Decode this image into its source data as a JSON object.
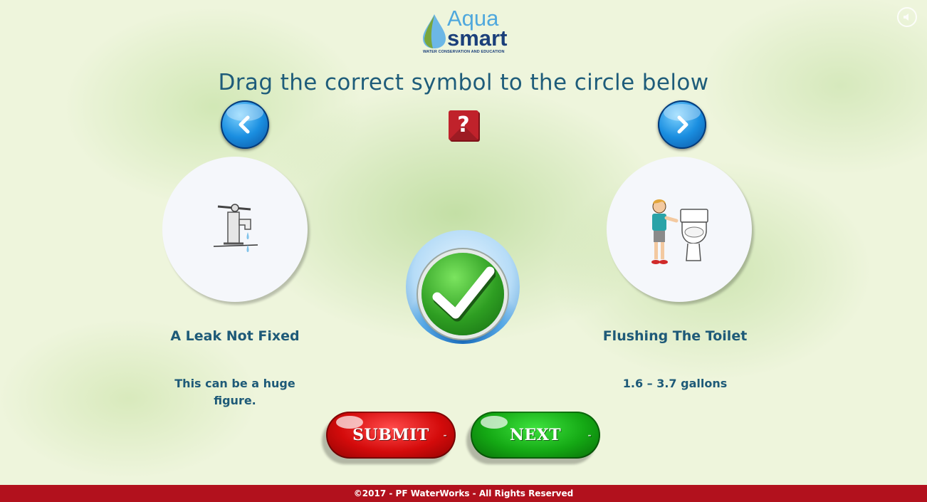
{
  "app": {
    "logo": {
      "line1": "Aqua",
      "line2": "smart",
      "tagline": "WATER CONSERVATION AND EDUCATION"
    },
    "icons": {
      "sound": "speaker-icon",
      "prev": "chevron-left-icon",
      "next": "chevron-right-icon",
      "help": "question-icon",
      "target": "checkmark-icon"
    }
  },
  "prompt": {
    "title": "Drag the correct symbol to the circle below"
  },
  "help": {
    "label": "?"
  },
  "cards": [
    {
      "label": "A Leak Not Fixed",
      "description": "This can be a huge figure.",
      "icon": "leaking-faucet-icon"
    },
    {
      "label": "Flushing The Toilet",
      "description": "1.6 – 3.7 gallons",
      "icon": "boy-toilet-icon"
    }
  ],
  "buttons": {
    "submit": "SUBMIT",
    "next": "NEXT"
  },
  "footer": {
    "text": "©2017 - PF WaterWorks - All Rights Reserved"
  },
  "colors": {
    "title": "#1e5c7a",
    "footer_bg": "#b2111d",
    "submit": "#d40b0b",
    "next": "#14a814",
    "help": "#c0222b"
  }
}
